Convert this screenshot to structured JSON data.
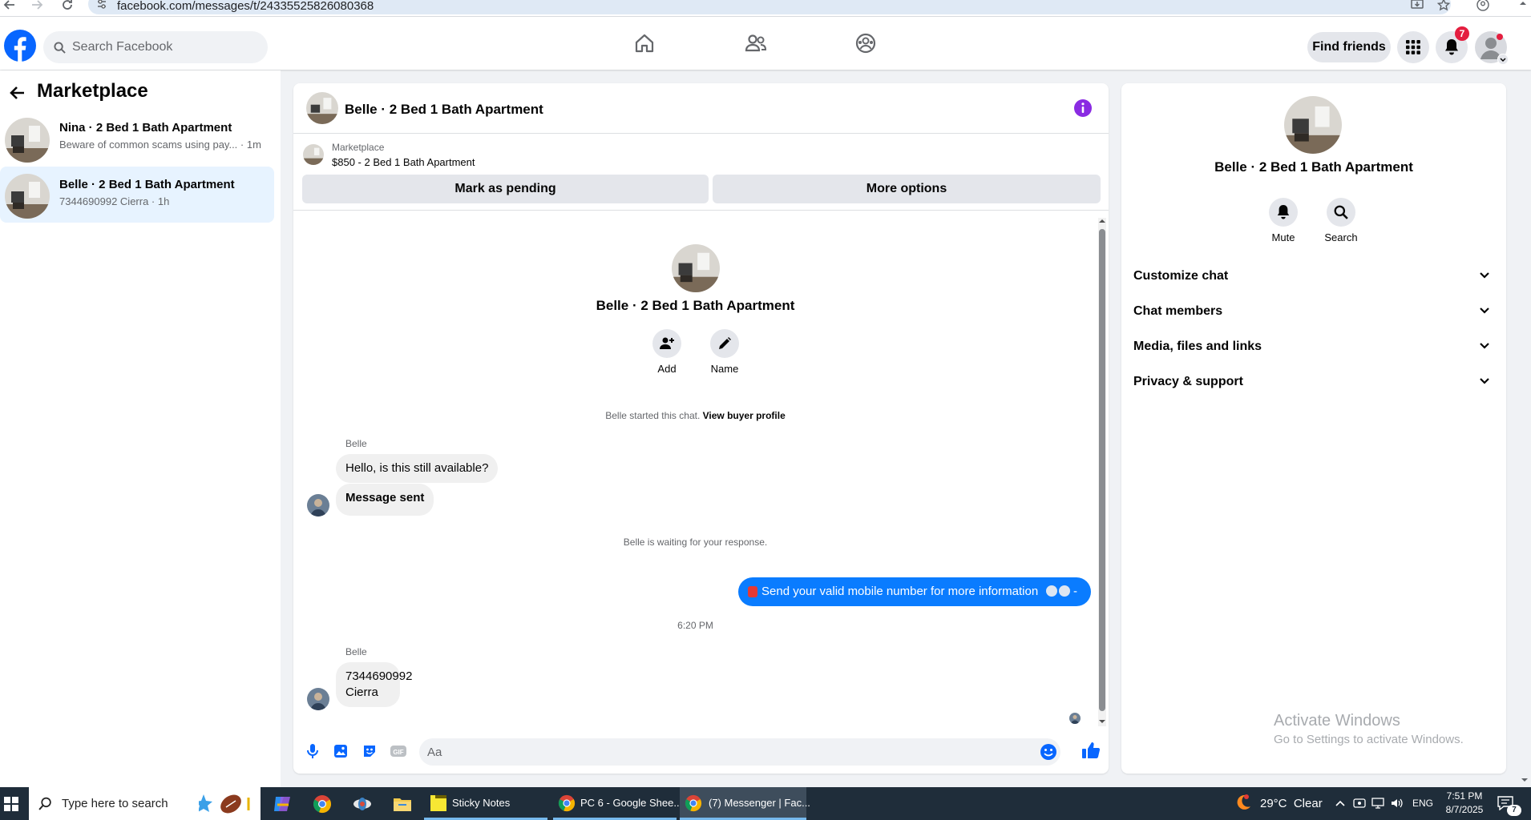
{
  "browser": {
    "url": "facebook.com/messages/t/24335525826080368"
  },
  "header": {
    "search_placeholder": "Search Facebook",
    "find_friends": "Find friends",
    "notification_count": "7"
  },
  "left_panel": {
    "title": "Marketplace",
    "conversations": [
      {
        "name": "Nina · 2 Bed 1 Bath Apartment",
        "preview": "Beware of common scams using pay... · 1m",
        "active": false
      },
      {
        "name": "Belle · 2 Bed 1 Bath Apartment",
        "preview": "7344690992 Cierra · 1h",
        "active": true
      }
    ]
  },
  "chat": {
    "title": "Belle · 2 Bed 1 Bath Apartment",
    "listing_label": "Marketplace",
    "listing_detail": "$850 - 2 Bed 1 Bath Apartment",
    "mark_pending": "Mark as pending",
    "more_options": "More options",
    "intro_name": "Belle · 2 Bed 1 Bath Apartment",
    "add_label": "Add",
    "name_label": "Name",
    "started_text": "Belle started this chat. ",
    "view_buyer_profile": "View buyer profile",
    "sender1": "Belle",
    "msg1": "Hello, is this still available?",
    "msg2": "Message sent",
    "waiting_text": "Belle is waiting for your response.",
    "outgoing": "Send your valid mobile number for more information",
    "outgoing_suffix": " -",
    "timestamp": "6:20 PM",
    "sender2": "Belle",
    "msg3_line1": "7344690992",
    "msg3_line2": "Cierra",
    "composer_placeholder": "Aa"
  },
  "info_panel": {
    "name": "Belle · 2 Bed 1 Bath Apartment",
    "mute": "Mute",
    "search": "Search",
    "sections": [
      "Customize chat",
      "Chat members",
      "Media, files and links",
      "Privacy & support"
    ]
  },
  "watermark": {
    "line1": "Activate Windows",
    "line2": "Go to Settings to activate Windows."
  },
  "taskbar": {
    "search_placeholder": "Type here to search",
    "apps": [
      "Sticky Notes",
      "PC 6 - Google Shee...",
      "(7) Messenger | Fac..."
    ],
    "weather": "29°C  Clear",
    "language": "ENG",
    "time": "7:51 PM",
    "date": "8/7/2025",
    "notif_count": "7"
  },
  "colors": {
    "fb_blue": "#0866ff",
    "send_bubble": "#0a7cff",
    "info_purple": "#8a2be2",
    "badge_red": "#e41e3f"
  }
}
